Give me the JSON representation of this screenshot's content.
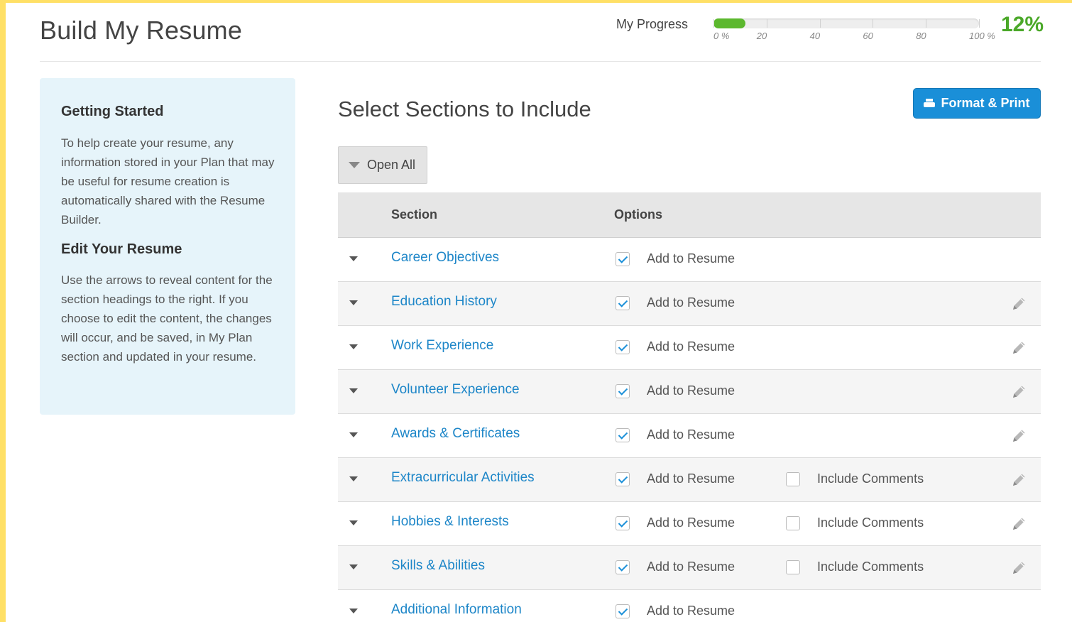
{
  "header": {
    "title": "Build My Resume",
    "progress_label": "My Progress",
    "progress_value": "12%",
    "progress_fraction": 0.12,
    "progress_ticks": [
      "0 %",
      "20",
      "40",
      "60",
      "80",
      "100 %"
    ]
  },
  "colors": {
    "accent": "#1a8fd8",
    "progress": "#5cb82e",
    "frame": "#ffe066",
    "sidebar_bg": "#e6f4fa"
  },
  "sidebar": {
    "heading1": "Getting Started",
    "text1": "To help create your resume, any information stored in your Plan that may be useful for resume creation is automatically shared with the Resume Builder.",
    "heading2": "Edit Your Resume",
    "text2": "Use the arrows to reveal content for the section headings to the right. If you choose to edit the content, the changes will occur, and be saved, in My Plan section and updated in your resume."
  },
  "main": {
    "title": "Select Sections to Include",
    "format_button": "Format & Print",
    "open_all": "Open All",
    "columns": [
      "Section",
      "Options"
    ],
    "rows": [
      {
        "section": "Career Objectives",
        "add_label": "Add to Resume",
        "added": true,
        "comments_label": "",
        "editable": false
      },
      {
        "section": "Education History",
        "add_label": "Add to Resume",
        "added": true,
        "comments_label": "",
        "editable": true
      },
      {
        "section": "Work Experience",
        "add_label": "Add to Resume",
        "added": true,
        "comments_label": "",
        "editable": true
      },
      {
        "section": "Volunteer Experience",
        "add_label": "Add to Resume",
        "added": true,
        "comments_label": "",
        "editable": true
      },
      {
        "section": "Awards & Certificates",
        "add_label": "Add to Resume",
        "added": true,
        "comments_label": "",
        "editable": true
      },
      {
        "section": "Extracurricular Activities",
        "add_label": "Add to Resume",
        "added": true,
        "comments_label": "Include Comments",
        "comments": false,
        "editable": true
      },
      {
        "section": "Hobbies & Interests",
        "add_label": "Add to Resume",
        "added": true,
        "comments_label": "Include Comments",
        "comments": false,
        "editable": true
      },
      {
        "section": "Skills & Abilities",
        "add_label": "Add to Resume",
        "added": true,
        "comments_label": "Include Comments",
        "comments": false,
        "editable": true
      },
      {
        "section": "Additional Information",
        "add_label": "Add to Resume",
        "added": true,
        "comments_label": "",
        "editable": false
      }
    ]
  }
}
